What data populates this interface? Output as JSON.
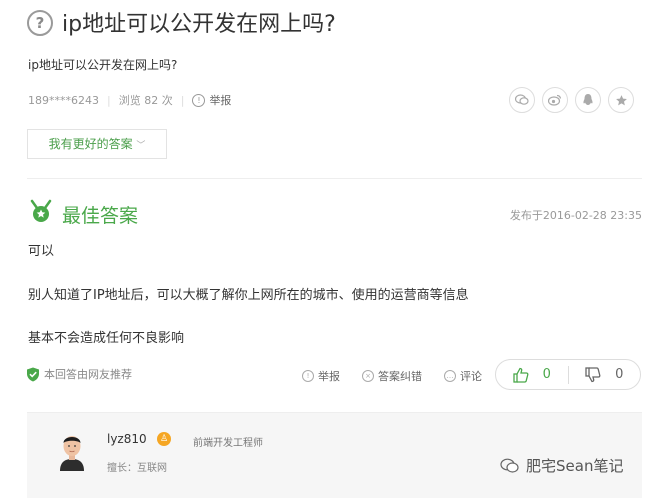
{
  "question": {
    "icon": "question-circle-icon",
    "title": "ip地址可以公开发在网上吗?",
    "description": "ip地址可以公开发在网上吗?",
    "asker": "189****6243",
    "views": "浏览 82 次",
    "report": "举报"
  },
  "share_icons": [
    "wechat-icon",
    "weibo-icon",
    "qq-icon",
    "favorite-star-icon"
  ],
  "better_answer_button": "我有更好的答案",
  "best_answer": {
    "label": "最佳答案",
    "date": "发布于2016-02-28 23:35",
    "lines": [
      "可以",
      "别人知道了IP地址后，可以大概了解你上网所在的城市、使用的运营商等信息",
      "基本不会造成任何不良影响"
    ],
    "recommended": "本回答由网友推荐",
    "actions": {
      "report": "举报",
      "correct": "答案纠错",
      "comment": "评论"
    },
    "likes": "0",
    "dislikes": "0"
  },
  "answerer": {
    "name": "lyz810",
    "title": "前端开发工程师",
    "expertise": "擅长：互联网"
  },
  "watermark": "肥宅Sean笔记",
  "colors": {
    "accent_green": "#4aa84a",
    "meta_gray": "#999999",
    "badge_orange": "#f5a623"
  }
}
